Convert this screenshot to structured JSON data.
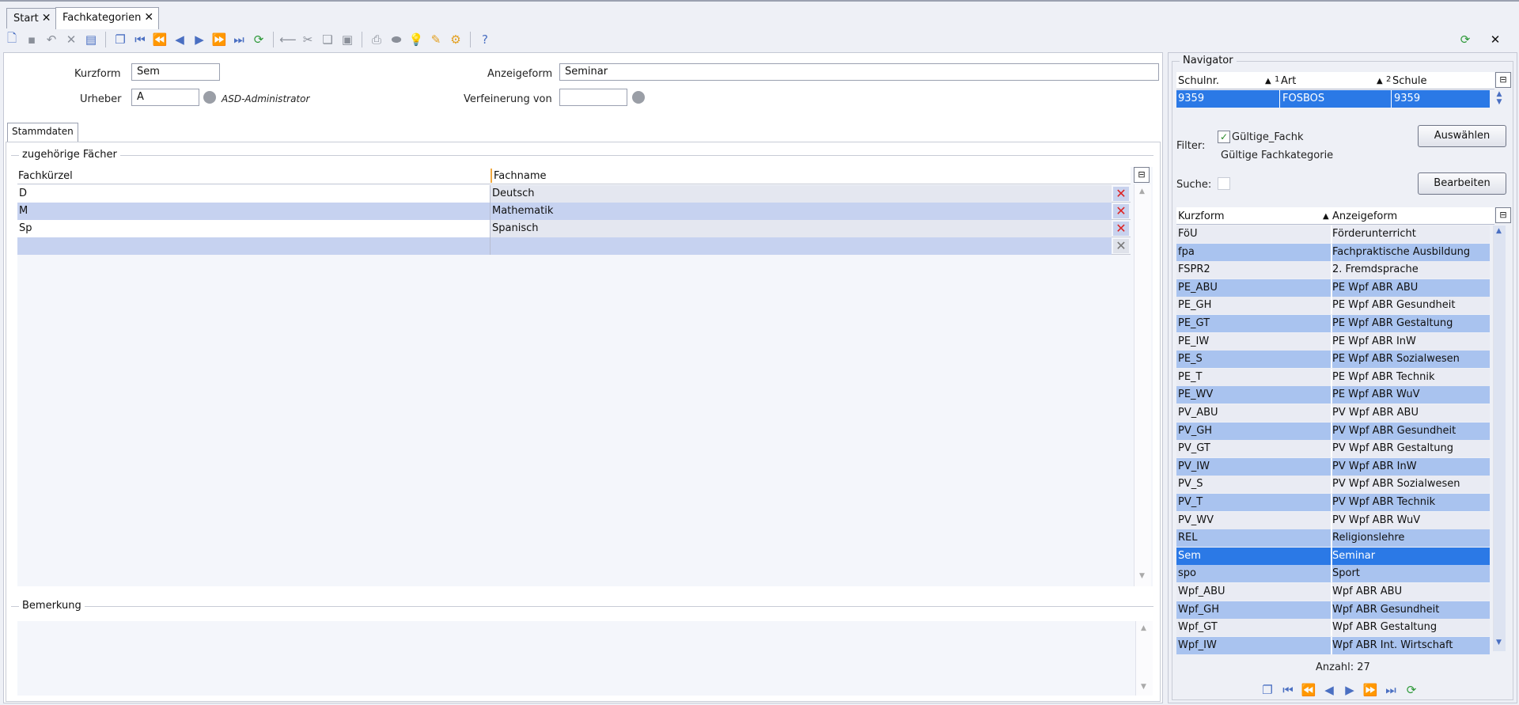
{
  "tabs": [
    {
      "label": "Start",
      "active": false
    },
    {
      "label": "Fachkategorien",
      "active": true
    }
  ],
  "toolbar": {
    "icons": [
      "new-icon",
      "save-icon",
      "undo-icon",
      "delete-icon",
      "print-form-icon",
      "copy-record-icon",
      "first-icon",
      "prev-page-icon",
      "prev-icon",
      "next-icon",
      "next-page-icon",
      "last-icon",
      "refresh-icon",
      "separator-icon",
      "cut-icon",
      "copy-icon",
      "paste-icon",
      "print-icon",
      "preview-icon",
      "hint-icon",
      "clear-icon",
      "settings-icon",
      "help-icon"
    ],
    "refresh_right": "refresh-icon",
    "close_right": "close-icon"
  },
  "form": {
    "kurzform_label": "Kurzform",
    "kurzform_value": "Sem",
    "anzeigeform_label": "Anzeigeform",
    "anzeigeform_value": "Seminar",
    "urheber_label": "Urheber",
    "urheber_value": "A",
    "urheber_name": "ASD-Administrator",
    "verfeinerung_label": "Verfeinerung von",
    "verfeinerung_value": ""
  },
  "subtab": {
    "label": "Stammdaten"
  },
  "faecher": {
    "group_title": "zugehörige Fächer",
    "columns": [
      "Fachkürzel",
      "Fachname"
    ],
    "rows": [
      {
        "kuerzel": "D",
        "name": "Deutsch"
      },
      {
        "kuerzel": "M",
        "name": "Mathematik"
      },
      {
        "kuerzel": "Sp",
        "name": "Spanisch"
      }
    ]
  },
  "bemerkung": {
    "group_title": "Bemerkung",
    "value": ""
  },
  "navigator": {
    "title": "Navigator",
    "school_columns": [
      "Schulnr.",
      "Art",
      "Schule"
    ],
    "school_sort": [
      "1",
      "2"
    ],
    "school_row": {
      "schulnr": "9359",
      "art": "FOSBOS",
      "schule": "9359"
    },
    "filter_label": "Filter:",
    "filter_checkbox_label": "Gültige_Fachk",
    "filter_checked": true,
    "filter_text": "Gültige Fachkategorie",
    "select_button": "Auswählen",
    "search_label": "Suche:",
    "edit_button": "Bearbeiten",
    "list_columns": [
      "Kurzform",
      "Anzeigeform"
    ],
    "list": [
      {
        "k": "FöU",
        "a": "Förderunterricht"
      },
      {
        "k": "fpa",
        "a": "Fachpraktische Ausbildung"
      },
      {
        "k": "FSPR2",
        "a": "2. Fremdsprache"
      },
      {
        "k": "PE_ABU",
        "a": "PE Wpf ABR ABU"
      },
      {
        "k": "PE_GH",
        "a": "PE Wpf ABR Gesundheit"
      },
      {
        "k": "PE_GT",
        "a": "PE Wpf ABR Gestaltung"
      },
      {
        "k": "PE_IW",
        "a": "PE Wpf ABR InW"
      },
      {
        "k": "PE_S",
        "a": "PE Wpf ABR Sozialwesen"
      },
      {
        "k": "PE_T",
        "a": "PE Wpf ABR Technik"
      },
      {
        "k": "PE_WV",
        "a": "PE Wpf ABR WuV"
      },
      {
        "k": "PV_ABU",
        "a": "PV Wpf ABR ABU"
      },
      {
        "k": "PV_GH",
        "a": "PV Wpf ABR Gesundheit"
      },
      {
        "k": "PV_GT",
        "a": "PV Wpf ABR Gestaltung"
      },
      {
        "k": "PV_IW",
        "a": "PV Wpf ABR InW"
      },
      {
        "k": "PV_S",
        "a": "PV Wpf ABR Sozialwesen"
      },
      {
        "k": "PV_T",
        "a": "PV Wpf ABR Technik"
      },
      {
        "k": "PV_WV",
        "a": "PV Wpf ABR WuV"
      },
      {
        "k": "REL",
        "a": "Religionslehre"
      },
      {
        "k": "Sem",
        "a": "Seminar"
      },
      {
        "k": "spo",
        "a": "Sport"
      },
      {
        "k": "Wpf_ABU",
        "a": "Wpf ABR ABU"
      },
      {
        "k": "Wpf_GH",
        "a": "Wpf ABR Gesundheit"
      },
      {
        "k": "Wpf_GT",
        "a": "Wpf ABR Gestaltung"
      },
      {
        "k": "Wpf_IW",
        "a": "Wpf ABR Int. Wirtschaft"
      }
    ],
    "selected_kurzform": "Sem",
    "count_text": "Anzahl: 27",
    "bottom_icons": [
      "copy-record-icon",
      "first-icon",
      "prev-page-icon",
      "prev-icon",
      "next-icon",
      "next-page-icon",
      "last-icon",
      "refresh-icon"
    ]
  },
  "colors": {
    "selection": "#2b79e6",
    "row_alt": "#a9c3ef",
    "delete": "#dd2222"
  }
}
